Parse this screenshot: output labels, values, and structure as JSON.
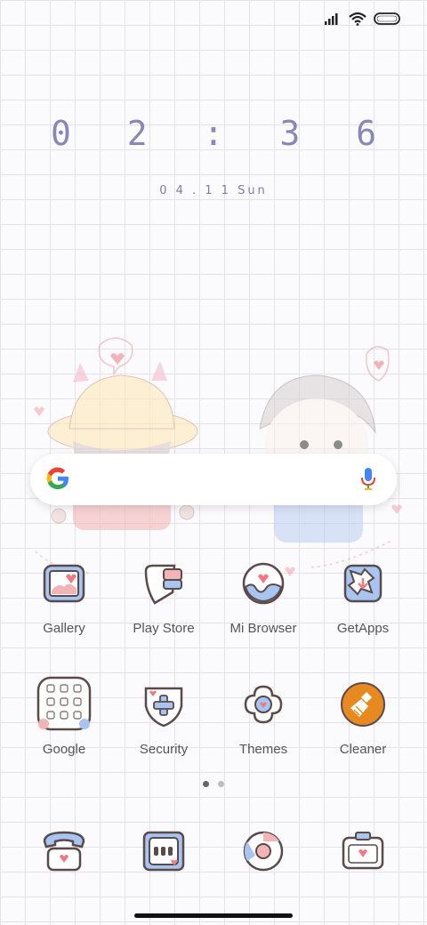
{
  "status": {
    "signal": "signal-icon",
    "wifi": "wifi-icon",
    "battery": "battery-icon"
  },
  "clock": {
    "time": "0 2 : 3 6",
    "date": "0 4 . 1 1 Sun"
  },
  "search": {
    "logo": "google-logo-icon",
    "mic": "mic-icon"
  },
  "apps": {
    "row1": [
      {
        "label": "Gallery"
      },
      {
        "label": "Play Store"
      },
      {
        "label": "Mi Browser"
      },
      {
        "label": "GetApps"
      }
    ],
    "row2": [
      {
        "label": "Google"
      },
      {
        "label": "Security"
      },
      {
        "label": "Themes"
      },
      {
        "label": "Cleaner"
      }
    ]
  },
  "dock": [
    "phone-icon",
    "messages-icon",
    "chrome-icon",
    "camera-icon"
  ],
  "colors": {
    "accent": "#8a87b8",
    "outline": "#5a4a4a",
    "blue": "#a8c4f0",
    "pink": "#f3b4b8",
    "cleaner": "#e68a1f"
  },
  "page_indicator": {
    "pages": 2,
    "active": 1
  }
}
